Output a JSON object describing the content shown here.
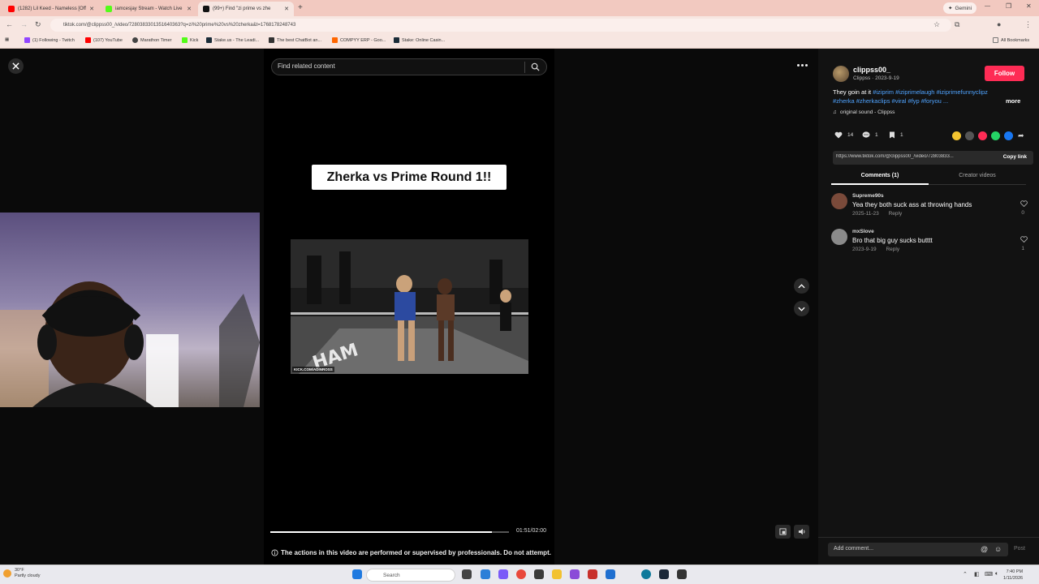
{
  "browser": {
    "tabs": [
      {
        "title": "(1282) Lil Keed - Nameless [Off",
        "favicon_color": "#ff0000"
      },
      {
        "title": "iamcesjay Stream - Watch Live",
        "favicon_color": "#53fc18"
      },
      {
        "title": "(99+) Find \"zi prime vs zhe",
        "favicon_color": "#111111"
      }
    ],
    "new_tab": "+",
    "gemini": "Gemini",
    "url": "tiktok.com/@clippss00_/video/7280383301351640363?q=zi%20prime%20vs%20zherka&t=1768178248743",
    "bookmarks": [
      {
        "label": "(1) Following - Twitch",
        "color": "#9146ff"
      },
      {
        "label": "(107) YouTube",
        "color": "#ff0000"
      },
      {
        "label": "Marathon Timer",
        "color": "#444444"
      },
      {
        "label": "Kick",
        "color": "#53fc18"
      },
      {
        "label": "Stake.us - The Leadi...",
        "color": "#1a2c38"
      },
      {
        "label": "The best ChatBot an...",
        "color": "#333333"
      },
      {
        "label": "COMPYY ERP - Goo...",
        "color": "#ff6600"
      },
      {
        "label": "Stake: Online Casin...",
        "color": "#1a2c38"
      }
    ],
    "all_bookmarks": "All Bookmarks"
  },
  "player": {
    "search_placeholder": "Find related content",
    "title_card": "Zherka vs Prime Round 1!!",
    "video_watermark": "KICK.COM/ADINROSS",
    "progress": 0.93,
    "time": "01:51/02:00",
    "disclaimer": "The actions in this video are performed or supervised by professionals. Do not attempt."
  },
  "author": {
    "username": "clippss00_",
    "info": "Clippss · 2023-9-19",
    "follow_label": "Follow",
    "caption_text": "They goin at it ",
    "caption_tags_1": "#iziprim #iziprimelaugh #iziprimefunnyclipz",
    "caption_tags_2": "#zherka #zherkaclips #viral #fyp #foryou ...",
    "more_label": "more",
    "sound": "original sound - Clippss"
  },
  "actions": {
    "likes": "14",
    "comments": "1",
    "saves": "1",
    "share_colors": [
      "#f4c430",
      "#555555",
      "#fe2c55",
      "#25d366",
      "#1877f2"
    ]
  },
  "link": {
    "url": "https://www.tiktok.com/@clippss00_/video/72803833...",
    "copy_label": "Copy link"
  },
  "tabs": {
    "comments": "Comments (1)",
    "videos": "Creator videos"
  },
  "comments": [
    {
      "user": "Supreme90s",
      "text": "Yea they both suck ass at throwing hands",
      "date": "2025-11-23",
      "reply": "Reply",
      "likes": "0",
      "avatar_color": "#7a4a3a"
    },
    {
      "user": "mxSlove",
      "text": "Bro that big guy sucks butttt",
      "date": "2023-9-19",
      "reply": "Reply",
      "likes": "1",
      "avatar_color": "#8a8a8a"
    }
  ],
  "comment_box": {
    "placeholder": "Add comment...",
    "post_label": "Post"
  },
  "taskbar": {
    "weather_temp": "30°F",
    "weather_desc": "Partly cloudy",
    "search_label": "Search",
    "time": "7:40 PM",
    "date": "1/11/2026"
  }
}
